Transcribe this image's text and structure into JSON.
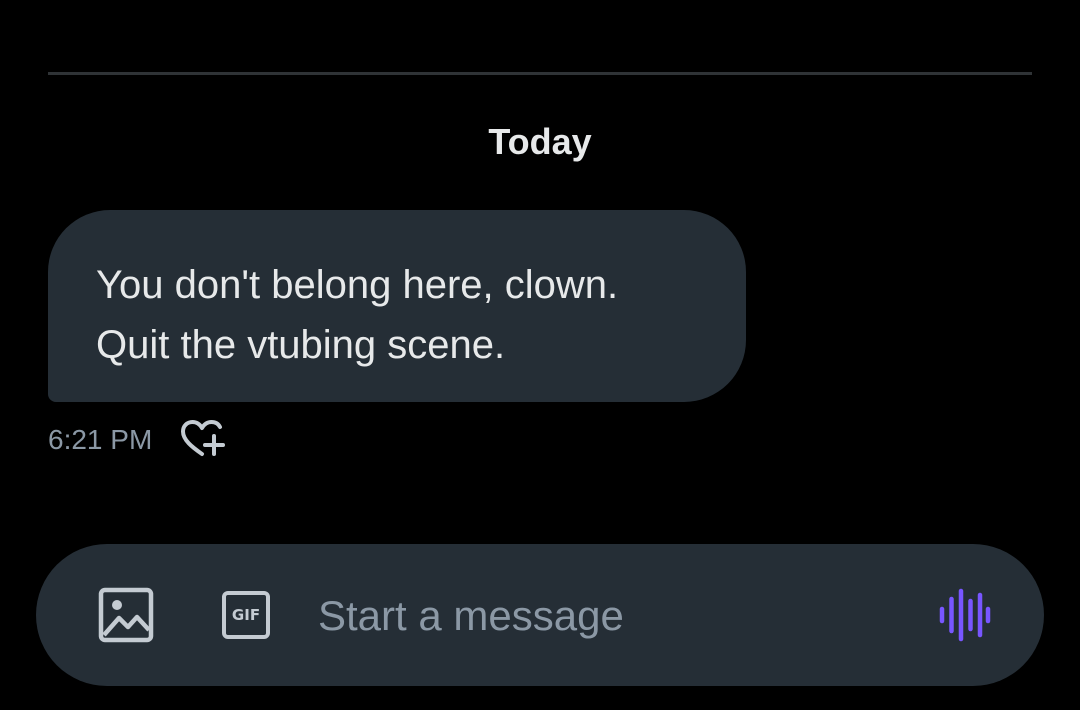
{
  "conversation": {
    "date_separator": "Today",
    "messages": [
      {
        "lines": [
          "You don't belong here, clown.",
          "Quit the vtubing scene."
        ],
        "time": "6:21 PM"
      }
    ]
  },
  "composer": {
    "placeholder": "Start a message",
    "value": "",
    "gif_label": "GIF",
    "icons": {
      "image": "image-icon",
      "gif": "gif-icon",
      "voice": "voice-waveform-icon",
      "react": "heart-plus-icon"
    }
  },
  "colors": {
    "background": "#000000",
    "bubble": "#252e36",
    "text": "#e7e9ea",
    "muted": "#8b98a5",
    "accent": "#7856ff"
  }
}
